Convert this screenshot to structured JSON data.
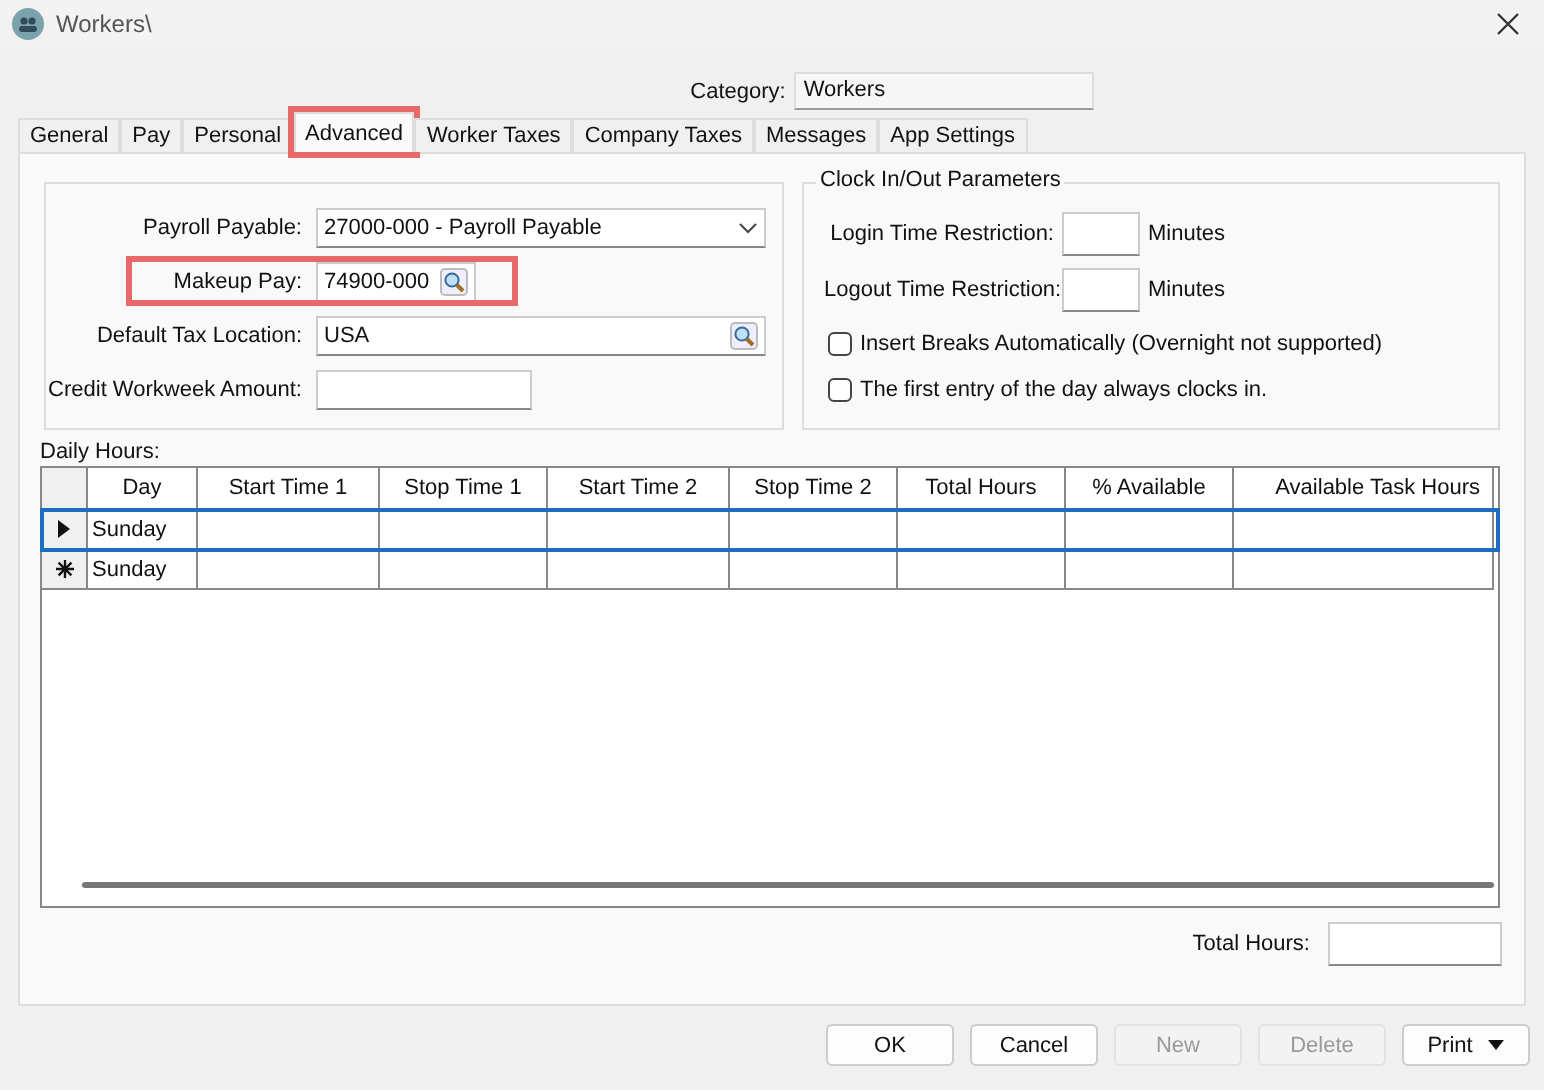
{
  "window": {
    "title": "Workers\\"
  },
  "category": {
    "label": "Category:",
    "value": "Workers"
  },
  "tabs": [
    {
      "label": "General",
      "selected": false,
      "highlighted": false
    },
    {
      "label": "Pay",
      "selected": false,
      "highlighted": false
    },
    {
      "label": "Personal",
      "selected": false,
      "highlighted": false
    },
    {
      "label": "Advanced",
      "selected": true,
      "highlighted": true
    },
    {
      "label": "Worker Taxes",
      "selected": false,
      "highlighted": false
    },
    {
      "label": "Company Taxes",
      "selected": false,
      "highlighted": false
    },
    {
      "label": "Messages",
      "selected": false,
      "highlighted": false
    },
    {
      "label": "App Settings",
      "selected": false,
      "highlighted": false
    }
  ],
  "accounts": [
    {
      "label": "Payroll Payable:",
      "value": "27000-000 - Payroll Payable",
      "kind": "dropdown",
      "highlighted": false
    },
    {
      "label": "Makeup Pay:",
      "value": "74900-000",
      "kind": "lookup-short",
      "highlighted": true
    },
    {
      "label": "Default Tax Location:",
      "value": "USA",
      "kind": "lookup",
      "highlighted": false
    },
    {
      "label": "Credit Workweek Amount:",
      "kind": "text",
      "highlighted": false
    }
  ],
  "clock": {
    "title": "Clock In/Out Parameters",
    "restrictions": [
      {
        "label": "Login Time Restriction:",
        "unit": "Minutes"
      },
      {
        "label": "Logout Time Restriction:",
        "unit": "Minutes"
      }
    ],
    "options": [
      {
        "label": "Insert Breaks Automatically (Overnight not supported)",
        "checked": false
      },
      {
        "label": "The first entry of the day always clocks in.",
        "checked": false
      }
    ]
  },
  "daily_hours": {
    "label": "Daily Hours:",
    "columns": [
      "Day",
      "Start Time 1",
      "Stop Time 1",
      "Start Time 2",
      "Stop Time 2",
      "Total Hours",
      "% Available",
      "Available Task Hours"
    ],
    "rows": [
      {
        "kind": "current",
        "selected": true,
        "cells": [
          "Sunday",
          "",
          "",
          "",
          "",
          "",
          "",
          ""
        ]
      },
      {
        "kind": "new",
        "selected": false,
        "cells": [
          "Sunday",
          "",
          "",
          "",
          "",
          "",
          "",
          ""
        ]
      }
    ]
  },
  "total_hours": {
    "label": "Total Hours:"
  },
  "buttons": [
    {
      "label": "OK",
      "disabled": false,
      "dropdown": false
    },
    {
      "label": "Cancel",
      "disabled": false,
      "dropdown": false
    },
    {
      "label": "New",
      "disabled": true,
      "dropdown": false
    },
    {
      "label": "Delete",
      "disabled": true,
      "dropdown": false
    },
    {
      "label": "Print",
      "disabled": false,
      "dropdown": true
    }
  ]
}
